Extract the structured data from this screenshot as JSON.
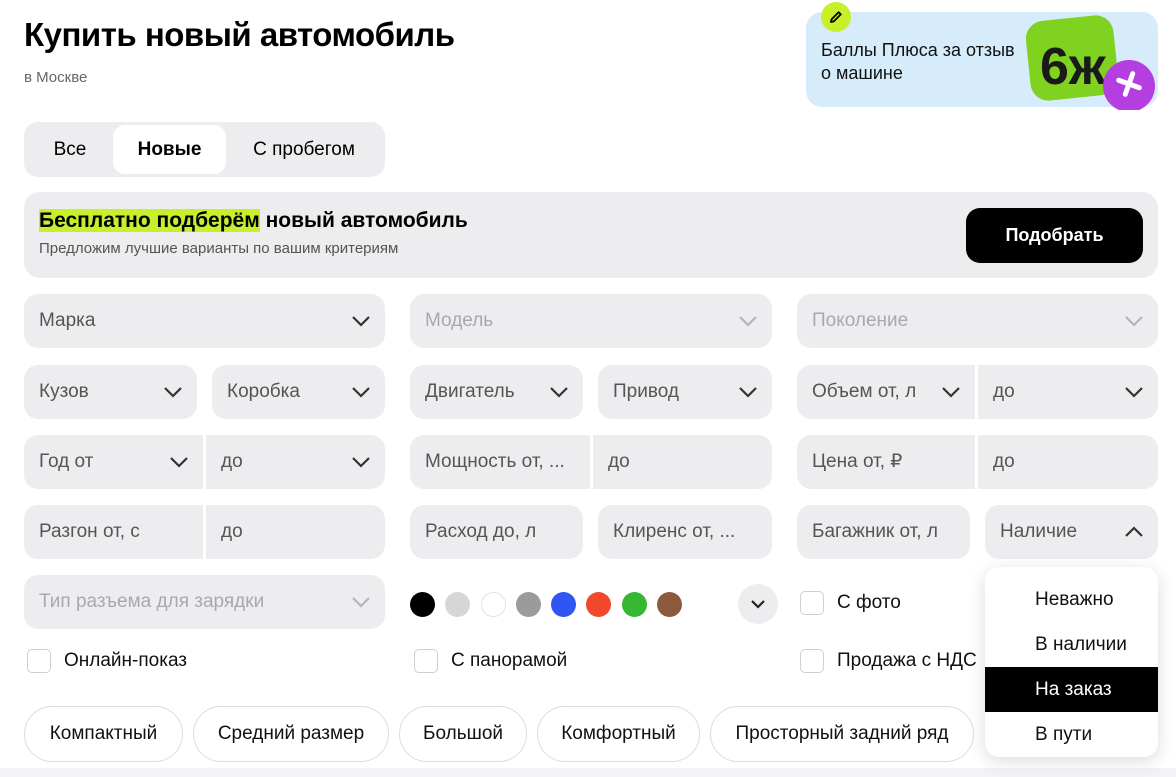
{
  "header": {
    "title": "Купить новый автомобиль",
    "location": "в Москве"
  },
  "promo": {
    "text": "Баллы Плюса за отзыв о машине",
    "logo_text": "6ж",
    "pencil_icon": "pencil-icon"
  },
  "tabs": [
    {
      "label": "Все",
      "active": false
    },
    {
      "label": "Новые",
      "active": true
    },
    {
      "label": "С пробегом",
      "active": false
    }
  ],
  "banner": {
    "title_highlight": "Бесплатно подберём",
    "title_rest": " новый автомобиль",
    "subtitle": "Предложим лучшие варианты по вашим критериям",
    "button": "Подобрать",
    "highlight_color": "#c7f02a"
  },
  "filters": {
    "brand": "Марка",
    "model": "Модель",
    "generation": "Поколение",
    "body": "Кузов",
    "gearbox": "Коробка",
    "engine": "Двигатель",
    "drive": "Привод",
    "volume_from": "Объем от, л",
    "volume_to": "до",
    "year_from": "Год от",
    "year_to": "до",
    "power_from": "Мощность от, ...",
    "power_to": "до",
    "price_from": "Цена от, ₽",
    "price_to": "до",
    "accel_from": "Разгон от, с",
    "accel_to": "до",
    "consumption": "Расход до, л",
    "clearance": "Клиренс от, ...",
    "trunk": "Багажник от, л",
    "availability": "Наличие",
    "connector": "Тип разъема для зарядки"
  },
  "colors": [
    "#000000",
    "#d6d6d6",
    "#ffffff",
    "#9b9b9b",
    "#2f55f2",
    "#f2482b",
    "#35b733",
    "#8b5a3c"
  ],
  "checkboxes": {
    "with_photo": "С фото",
    "online_show": "Онлайн-показ",
    "panorama": "С панорамой",
    "vat": "Продажа с НДС"
  },
  "chips": [
    "Компактный",
    "Средний размер",
    "Большой",
    "Комфортный",
    "Просторный задний ряд"
  ],
  "availability_dropdown": {
    "options": [
      "Неважно",
      "В наличии",
      "На заказ",
      "В пути"
    ],
    "selected": "На заказ"
  }
}
